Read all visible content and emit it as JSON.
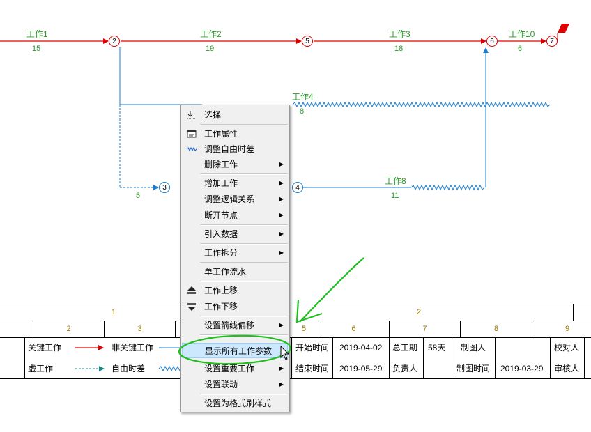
{
  "network": {
    "works": [
      {
        "name": "工作1",
        "duration": "15"
      },
      {
        "name": "工作2",
        "duration": "19"
      },
      {
        "name": "工作3",
        "duration": "18"
      },
      {
        "name": "工作10",
        "duration": "6"
      },
      {
        "name": "工作4",
        "duration": "8"
      },
      {
        "name": "工作8",
        "duration": "11"
      },
      {
        "name": "",
        "duration": "5"
      }
    ],
    "nodes": [
      "2",
      "5",
      "6",
      "7",
      "3",
      "4"
    ],
    "colors": {
      "critical": "#e00000",
      "noncritical": "#1a7fd0",
      "label": "#2a9a2a"
    }
  },
  "timeline": {
    "top_row": [
      "1",
      "2"
    ],
    "second_row": [
      "2",
      "3",
      "5",
      "6",
      "7",
      "8",
      "9"
    ]
  },
  "legend": {
    "critical_label": "关键工作",
    "noncritical_label": "非关键工作",
    "dummy_label": "虚工作",
    "free_float_label": "自由时差"
  },
  "info": {
    "start_label": "开始时间",
    "start_value": "2019-04-02",
    "end_label": "结束时间",
    "end_value": "2019-05-29",
    "total_label": "总工期",
    "total_value": "58天",
    "owner_label": "负责人",
    "owner_value": "",
    "drafter_label": "制图人",
    "drafter_value": "",
    "draft_time_label": "制图时间",
    "draft_time_value": "2019-03-29",
    "checker_label": "校对人",
    "reviewer_label": "审核人"
  },
  "menu": {
    "items": [
      {
        "label": "选择",
        "icon": "select-icon",
        "submenu": false
      },
      {
        "label": "工作属性",
        "icon": "properties-icon",
        "submenu": false
      },
      {
        "label": "调整自由时差",
        "icon": "wave-icon",
        "submenu": false
      },
      {
        "label": "删除工作",
        "icon": "",
        "submenu": true
      },
      {
        "label": "增加工作",
        "icon": "",
        "submenu": true
      },
      {
        "label": "调整逻辑关系",
        "icon": "",
        "submenu": true
      },
      {
        "label": "断开节点",
        "icon": "",
        "submenu": true
      },
      {
        "label": "引入数据",
        "icon": "",
        "submenu": true
      },
      {
        "label": "工作拆分",
        "icon": "",
        "submenu": true
      },
      {
        "label": "单工作流水",
        "icon": "",
        "submenu": false
      },
      {
        "label": "工作上移",
        "icon": "move-up-icon",
        "submenu": false
      },
      {
        "label": "工作下移",
        "icon": "move-down-icon",
        "submenu": false
      },
      {
        "label": "设置箭线偏移",
        "icon": "",
        "submenu": true
      },
      {
        "label": "显示所有工作参数",
        "icon": "",
        "submenu": false
      },
      {
        "label": "设置重要工作",
        "icon": "",
        "submenu": true
      },
      {
        "label": "设置联动",
        "icon": "",
        "submenu": true
      },
      {
        "label": "设置为格式刷样式",
        "icon": "",
        "submenu": false
      }
    ],
    "highlighted": "显示所有工作参数"
  }
}
